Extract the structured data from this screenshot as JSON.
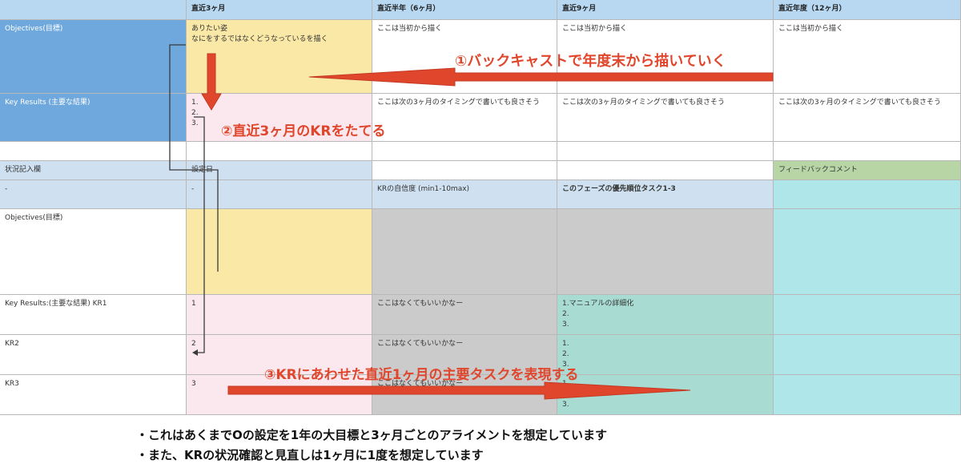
{
  "header": {
    "corner": "",
    "col1": "直近3ヶ月",
    "col2": "直近半年（6ヶ月）",
    "col3": "直近9ヶ月",
    "col4": "直近年度（12ヶ月）"
  },
  "objectives_row": {
    "label": "Objectives(目標)",
    "col1_line1": "ありたい姿",
    "col1_line2": "なにをするではなくどうなっているを描く",
    "col2": "ここは当初から描く",
    "col3": "ここは当初から描く",
    "col4": "ここは当初から描く"
  },
  "kr_row": {
    "label": "Key Results (主要な結果)",
    "col1_items": [
      "1.",
      "2.",
      "3."
    ],
    "col2": "ここは次の3ヶ月のタイミングで書いても良さそう",
    "col3": "ここは次の3ヶ月のタイミングで書いても良さそう",
    "col4": "ここは次の3ヶ月のタイミングで書いても良さそう"
  },
  "status_header": {
    "label": "状況記入欄",
    "col1": "設定日",
    "col4": "フィードバックコメント"
  },
  "status_sub": {
    "label": "-",
    "col1": "-",
    "col2": "KRの自信度 (min1-10max)",
    "col3": "このフェーズの優先順位タスク1-3"
  },
  "status_objectives": {
    "label": "Objectives(目標)"
  },
  "kr1": {
    "label": "Key Results:(主要な結果) KR1",
    "col1": "1",
    "col2": "ここはなくてもいいかなー",
    "col3_items": [
      "1.マニュアルの詳細化",
      "2.",
      "3."
    ]
  },
  "kr2": {
    "label": "KR2",
    "col1": "2",
    "col2": "ここはなくてもいいかなー",
    "col3_items": [
      "1.",
      "2.",
      "3."
    ]
  },
  "kr3": {
    "label": "KR3",
    "col1": "3",
    "col2": "ここはなくてもいいかなー",
    "col3_items": [
      "1.",
      "2.",
      "3."
    ]
  },
  "annotations": {
    "a1": "①バックキャストで年度末から描いていく",
    "a2": "②直近3ヶ月のKRをたてる",
    "a3": "③KRにあわせた直近1ヶ月の主要タスクを表現する"
  },
  "notes": {
    "line1": "・これはあくまでOの設定を1年の大目標と3ヶ月ごとのアライメントを想定しています",
    "line2": "・また、KRの状況確認と見直しは1ヶ月に1度を想定しています"
  },
  "colors": {
    "header": "#b8d8f2",
    "objective_label": "#6ea8dc",
    "current_objective": "#f9e8a6",
    "current_kr": "#fbe8ee",
    "feedback_header": "#b8d5a6",
    "confidence": "#cbcbcb",
    "tasks": "#a8dcd2",
    "feedback": "#aee6ea",
    "annotation": "#e0462c"
  }
}
